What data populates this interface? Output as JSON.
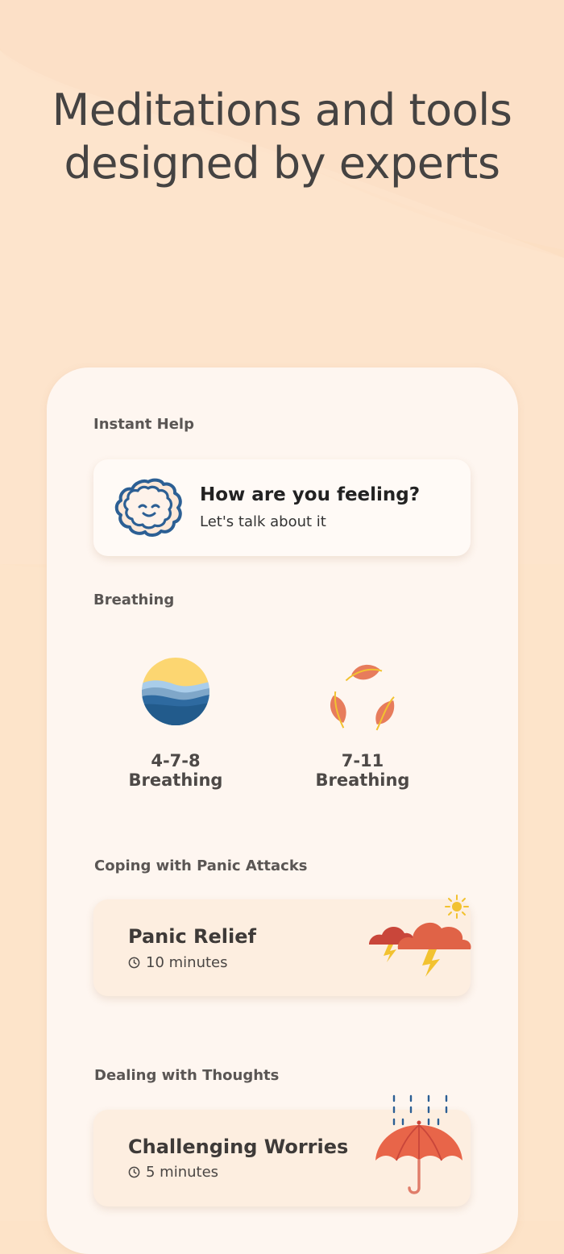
{
  "headline": {
    "line1": "Meditations and tools",
    "line2": "designed by experts"
  },
  "sections": {
    "instant_help": {
      "label": "Instant Help",
      "card": {
        "title": "How are you feeling?",
        "subtitle": "Let's talk about it",
        "icon": "smiling-cloud-icon"
      }
    },
    "breathing": {
      "label": "Breathing",
      "items": [
        {
          "label": "4-7-8 Breathing",
          "icon": "sunset-ocean-icon"
        },
        {
          "label": "7-11 Breathing",
          "icon": "falling-leaves-icon"
        }
      ]
    },
    "panic": {
      "label": "Coping with Panic Attacks",
      "card": {
        "title": "Panic Relief",
        "duration": "10 minutes",
        "icon": "storm-clouds-icon"
      }
    },
    "thoughts": {
      "label": "Dealing with Thoughts",
      "card": {
        "title": "Challenging Worries",
        "duration": "5 minutes",
        "icon": "umbrella-rain-icon"
      }
    }
  },
  "colors": {
    "background": "#fde3c8",
    "card": "#fef6f0",
    "text_dark": "#454342",
    "cloud_blue": "#2c5f94",
    "accent_red": "#d9573f"
  }
}
